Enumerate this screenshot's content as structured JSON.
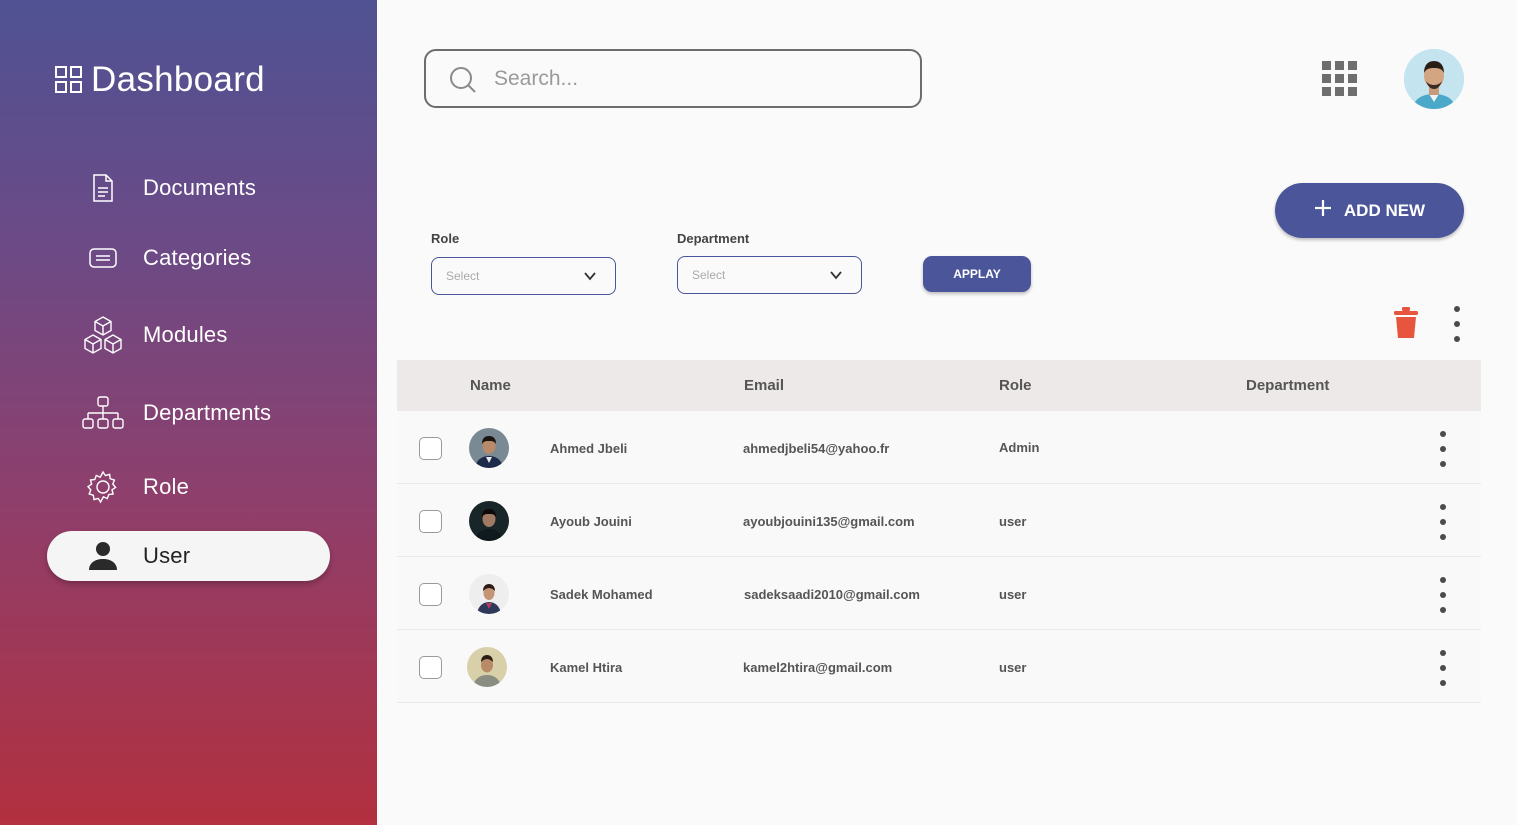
{
  "sidebar": {
    "brand": "Dashboard",
    "items": [
      {
        "label": "Documents",
        "icon": "document-icon"
      },
      {
        "label": "Categories",
        "icon": "categories-icon"
      },
      {
        "label": "Modules",
        "icon": "modules-icon"
      },
      {
        "label": "Departments",
        "icon": "departments-icon"
      },
      {
        "label": "Role",
        "icon": "gear-icon"
      },
      {
        "label": "User",
        "icon": "user-icon",
        "active": true
      }
    ]
  },
  "header": {
    "search_placeholder": "Search..."
  },
  "actions": {
    "add_new_label": "ADD NEW",
    "apply_label": "APPLAY"
  },
  "filters": {
    "role_label": "Role",
    "role_value": "Select",
    "department_label": "Department",
    "department_value": "Select"
  },
  "table": {
    "columns": [
      "Name",
      "Email",
      "Role",
      "Department"
    ],
    "rows": [
      {
        "name": "Ahmed Jbeli",
        "email": "ahmedjbeli54@yahoo.fr",
        "role": "Admin",
        "department": ""
      },
      {
        "name": "Ayoub Jouini",
        "email": "ayoubjouini135@gmail.com",
        "role": "user",
        "department": ""
      },
      {
        "name": "Sadek Mohamed",
        "email": "sadeksaadi2010@gmail.com",
        "role": "user",
        "department": ""
      },
      {
        "name": "Kamel Htira",
        "email": "kamel2htira@gmail.com",
        "role": "user",
        "department": ""
      }
    ]
  },
  "colors": {
    "accent": "#4a5699",
    "danger": "#e8553f",
    "sidebar_top": "#4f5293",
    "sidebar_bottom": "#b2303f"
  }
}
